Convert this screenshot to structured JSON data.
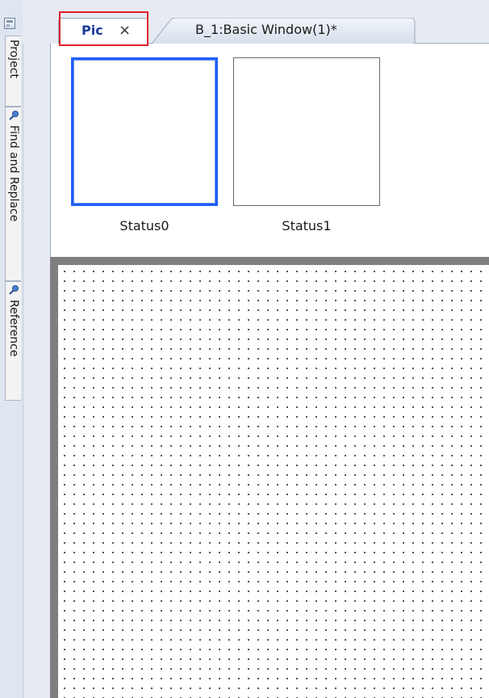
{
  "sidebar": {
    "items": [
      {
        "label": "Project",
        "icon": "window-icon"
      },
      {
        "label": "Find and Replace",
        "icon": "pin-icon"
      },
      {
        "label": "Reference",
        "icon": "pin-icon"
      }
    ]
  },
  "tabs": [
    {
      "label": "Pic",
      "close": "×",
      "active": true
    },
    {
      "label": "B_1:Basic Window(1)*",
      "active": false
    }
  ],
  "statuses": [
    {
      "label": "Status0",
      "selected": true
    },
    {
      "label": "Status1",
      "selected": false
    }
  ],
  "colors": {
    "selection_border": "#1f5fff",
    "highlight_box": "#e0202a",
    "active_tab_text": "#1b3a9c",
    "canvas_frame": "#7f7f7f"
  }
}
